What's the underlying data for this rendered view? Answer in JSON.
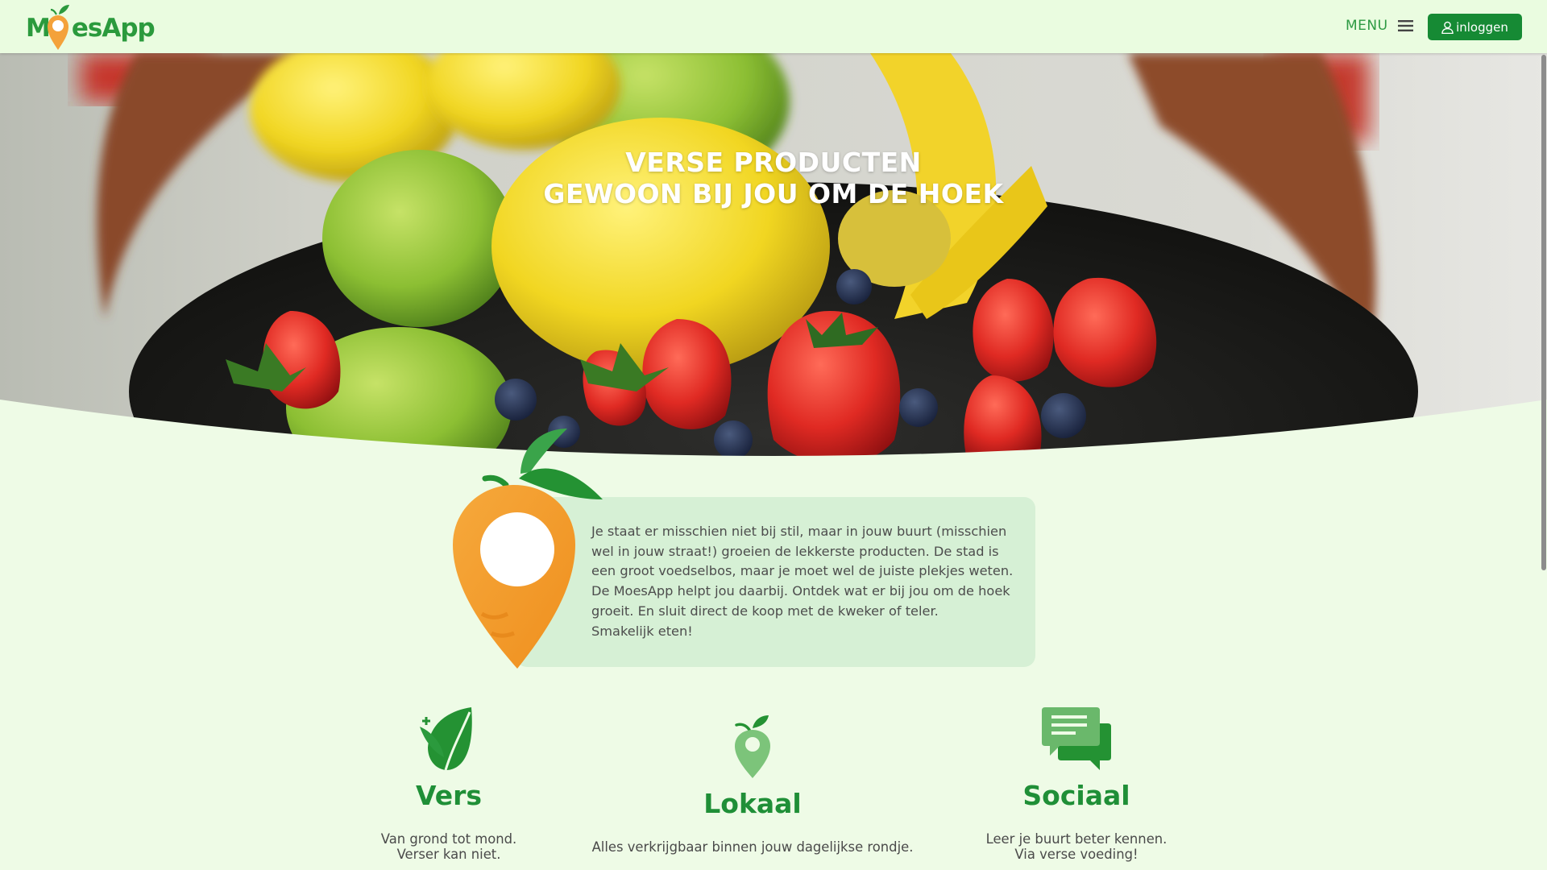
{
  "header": {
    "logo_text": "MoesApp",
    "menu_label": "MENU",
    "login_label": "inloggen"
  },
  "hero": {
    "title_line1": "VERSE PRODUCTEN",
    "title_line2": "GEWOON BIJ JOU OM DE HOEK"
  },
  "intro": {
    "paragraph": "Je staat er misschien niet bij stil, maar in jouw buurt (misschien wel in jouw straat!) groeien de lekkerste producten. De stad is een groot voedselbos, maar je moet wel de juiste plekjes weten. De MoesApp helpt jou daarbij. Ontdek wat er bij jou om de hoek groeit. En sluit direct de koop met de kweker of teler.",
    "closing": "Smakelijk eten!"
  },
  "features": [
    {
      "title": "Vers",
      "line1": "Van grond tot mond.",
      "line2": "Verser kan niet.",
      "icon": "leaf-icon"
    },
    {
      "title": "Lokaal",
      "line1": "Alles verkrijgbaar binnen jouw dagelijkse rondje.",
      "line2": "",
      "icon": "location-pin-icon"
    },
    {
      "title": "Sociaal",
      "line1": "Leer je buurt beter kennen.",
      "line2": "Via verse voeding!",
      "icon": "chat-bubbles-icon"
    }
  ],
  "colors": {
    "brand_green": "#1f8f37",
    "button_green": "#168a34",
    "header_bg": "#eafce0",
    "page_bg": "#eefbe6",
    "card_bg": "#d6f0d5",
    "carrot_orange": "#f4a23a"
  }
}
